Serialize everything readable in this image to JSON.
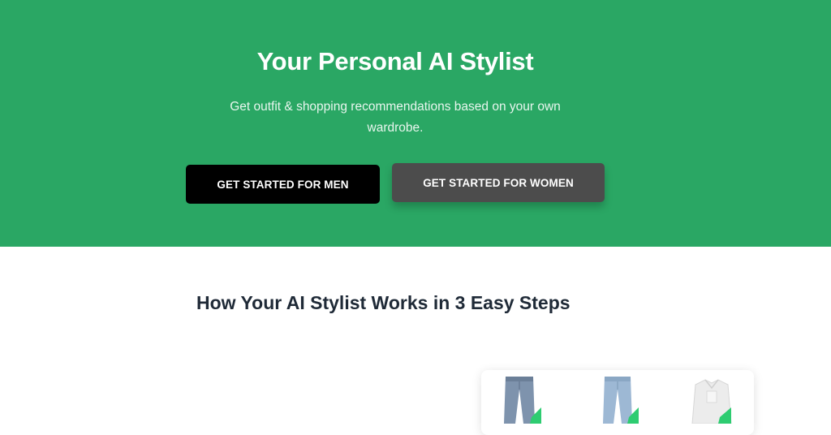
{
  "hero": {
    "title": "Your Personal AI Stylist",
    "subtitle": "Get outfit & shopping recommendations based on your own wardrobe.",
    "background_color": "#2aa764"
  },
  "buttons": {
    "men_label": "GET STARTED FOR MEN",
    "women_label": "GET STARTED FOR WOMEN"
  },
  "steps": {
    "title": "How Your AI Stylist Works in 3 Easy Steps"
  },
  "wardrobe_card": {
    "items": [
      {
        "icon": "jeans-icon"
      },
      {
        "icon": "light-jeans-icon"
      },
      {
        "icon": "white-shirt-icon"
      }
    ],
    "check_color": "#2ecc71"
  }
}
